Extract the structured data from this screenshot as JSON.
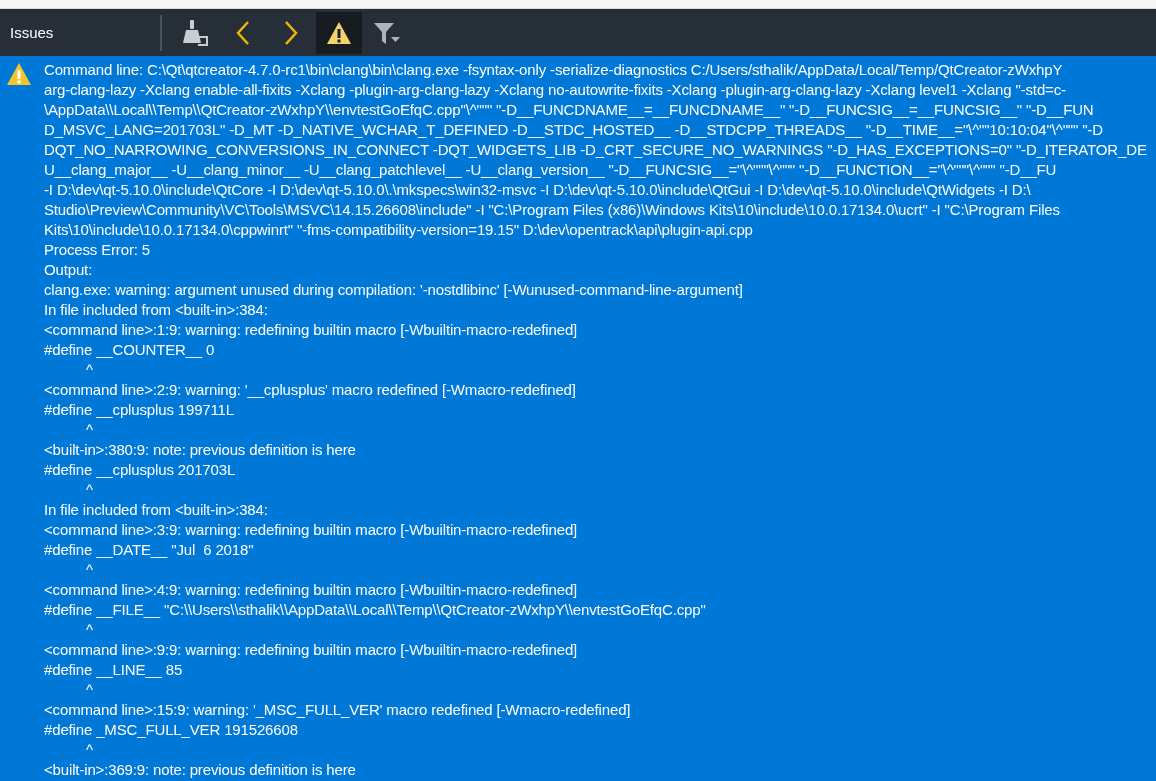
{
  "toolbar": {
    "title": "Issues",
    "buttons": [
      {
        "kind": "clear",
        "selected": false
      },
      {
        "kind": "prev",
        "selected": false
      },
      {
        "kind": "next",
        "selected": false
      },
      {
        "kind": "warning",
        "selected": true
      },
      {
        "kind": "filter",
        "selected": false
      }
    ]
  },
  "issue": {
    "kind": "warning",
    "lines": [
      {
        "text": "Command line: C:\\Qt\\qtcreator-4.7.0-rc1\\bin\\clang\\bin\\clang.exe -fsyntax-only -serialize-diagnostics C:/Users/sthalik/AppData/Local/Temp/QtCreator-zWxhpY"
      },
      {
        "text": "arg-clang-lazy -Xclang enable-all-fixits -Xclang -plugin-arg-clang-lazy -Xclang no-autowrite-fixits -Xclang -plugin-arg-clang-lazy -Xclang level1 -Xclang \"-std=c-"
      },
      {
        "text": "\\AppData\\\\Local\\\\Temp\\\\QtCreator-zWxhpY\\\\envtestGoEfqC.cpp\"\\^\"\"\" \"-D__FUNCDNAME__=__FUNCDNAME__\" \"-D__FUNCSIG__=__FUNCSIG__\" \"-D__FUN"
      },
      {
        "text": "D_MSVC_LANG=201703L\" -D_MT -D_NATIVE_WCHAR_T_DEFINED -D__STDC_HOSTED__ -D__STDCPP_THREADS__ \"-D__TIME__=\"\\^\"\"10:10:04\"\\^\"\"\" \"-D"
      },
      {
        "text": "DQT_NO_NARROWING_CONVERSIONS_IN_CONNECT -DQT_WIDGETS_LIB -D_CRT_SECURE_NO_WARNINGS \"-D_HAS_EXCEPTIONS=0\" \"-D_ITERATOR_DE"
      },
      {
        "text": "U__clang_major__ -U__clang_minor__ -U__clang_patchlevel__ -U__clang_version__ \"-D__FUNCSIG__=\"\\^\"\"\"\\^\"\"\" \"-D__FUNCTION__=\"\\^\"\"\"\\^\"\"\" \"-D__FU"
      },
      {
        "text": "-I D:\\dev\\qt-5.10.0\\include\\QtCore -I D:\\dev\\qt-5.10.0\\.\\mkspecs\\win32-msvc -I D:\\dev\\qt-5.10.0\\include\\QtGui -I D:\\dev\\qt-5.10.0\\include\\QtWidgets -I D:\\"
      },
      {
        "text": "Studio\\Preview\\Community\\VC\\Tools\\MSVC\\14.15.26608\\include\" -I \"C:\\Program Files (x86)\\Windows Kits\\10\\include\\10.0.17134.0\\ucrt\" -I \"C:\\Program Files"
      },
      {
        "text": "Kits\\10\\include\\10.0.17134.0\\cppwinrt\" \"-fms-compatibility-version=19.15\" D:\\dev\\opentrack\\api\\plugin-api.cpp"
      },
      {
        "text": "Process Error: 5"
      },
      {
        "text": "Output:"
      },
      {
        "text": "clang.exe: warning: argument unused during compilation: '-nostdlibinc' [-Wunused-command-line-argument]"
      },
      {
        "text": "In file included from <built-in>:384:"
      },
      {
        "text": "<command line>:1:9: warning: redefining builtin macro [-Wbuiltin-macro-redefined]"
      },
      {
        "text": "#define __COUNTER__ 0"
      },
      {
        "kind": "caret",
        "text": "^"
      },
      {
        "text": "<command line>:2:9: warning: '__cplusplus' macro redefined [-Wmacro-redefined]"
      },
      {
        "text": "#define __cplusplus 199711L"
      },
      {
        "kind": "caret",
        "text": "^"
      },
      {
        "text": "<built-in>:380:9: note: previous definition is here"
      },
      {
        "text": "#define __cplusplus 201703L"
      },
      {
        "kind": "caret",
        "text": "^"
      },
      {
        "text": "In file included from <built-in>:384:"
      },
      {
        "text": "<command line>:3:9: warning: redefining builtin macro [-Wbuiltin-macro-redefined]"
      },
      {
        "text": "#define __DATE__ \"Jul  6 2018\""
      },
      {
        "kind": "caret",
        "text": "^"
      },
      {
        "text": "<command line>:4:9: warning: redefining builtin macro [-Wbuiltin-macro-redefined]"
      },
      {
        "text": "#define __FILE__ \"C:\\\\Users\\\\sthalik\\\\AppData\\\\Local\\\\Temp\\\\QtCreator-zWxhpY\\\\envtestGoEfqC.cpp\""
      },
      {
        "kind": "caret",
        "text": "^"
      },
      {
        "text": "<command line>:9:9: warning: redefining builtin macro [-Wbuiltin-macro-redefined]"
      },
      {
        "text": "#define __LINE__ 85"
      },
      {
        "kind": "caret",
        "text": "^"
      },
      {
        "text": "<command line>:15:9: warning: '_MSC_FULL_VER' macro redefined [-Wmacro-redefined]"
      },
      {
        "text": "#define _MSC_FULL_VER 191526608"
      },
      {
        "kind": "caret",
        "text": "^"
      },
      {
        "text": "<built-in>:369:9: note: previous definition is here"
      }
    ]
  }
}
